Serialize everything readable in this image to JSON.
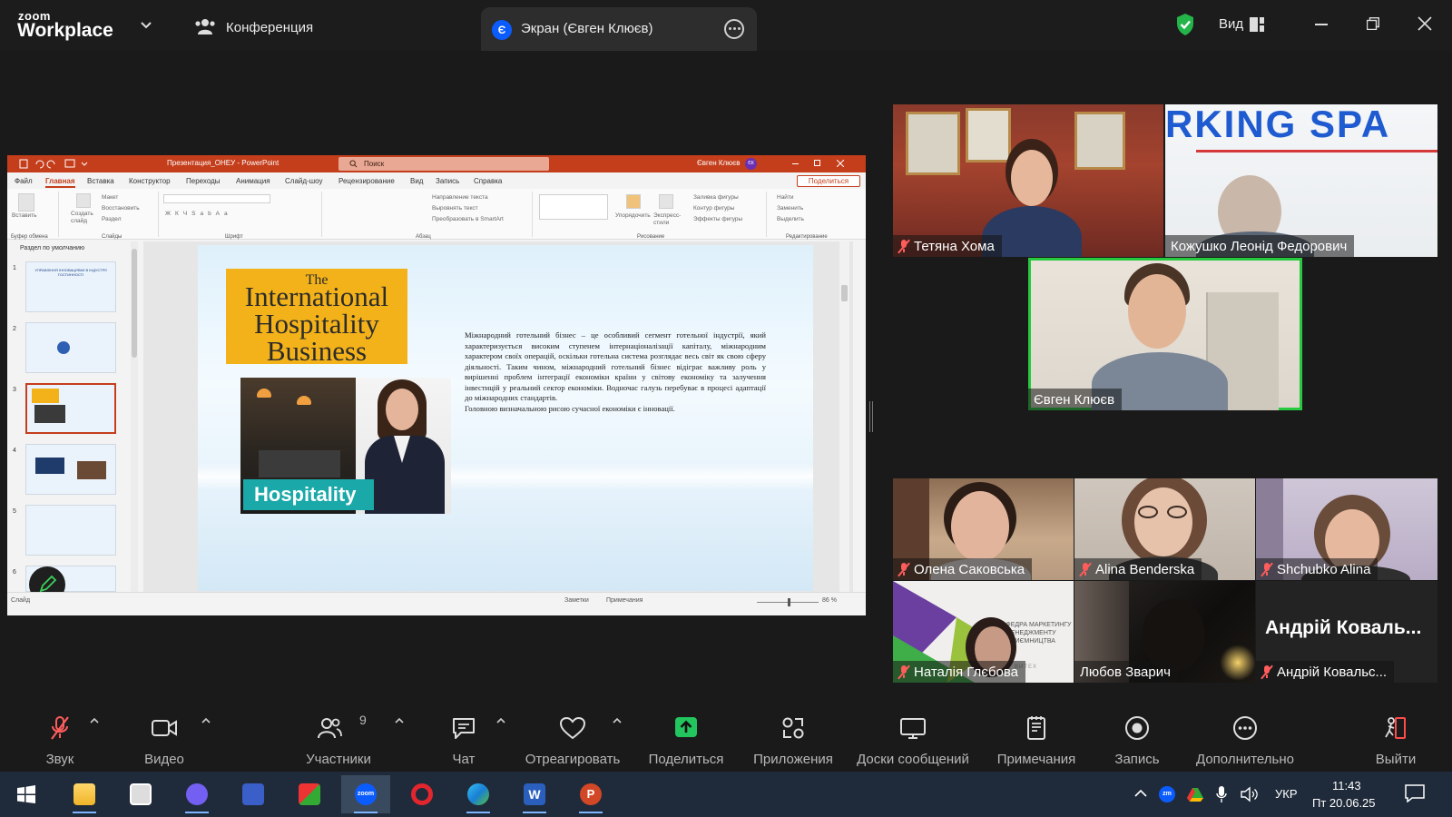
{
  "header": {
    "logo_small": "zoom",
    "logo_big": "Workplace",
    "conference_label": "Конференция",
    "screen_tab_initial": "Є",
    "screen_tab_label": "Экран (Євген Клюєв)",
    "view_label": "Вид",
    "shield_color": "#24b54a"
  },
  "ppt": {
    "doc_title": "Презентация_ОНЕУ - PowerPoint",
    "search_placeholder": "Поиск",
    "user_name": "Євген Клюєв",
    "user_initials": "ЄК",
    "share_label": "Поделиться",
    "tabs": [
      "Файл",
      "Главная",
      "Вставка",
      "Конструктор",
      "Переходы",
      "Анимация",
      "Слайд-шоу",
      "Рецензирование",
      "Вид",
      "Запись",
      "Справка"
    ],
    "active_tab": "Главная",
    "ribbon": {
      "paste": "Вставить",
      "create_slide": "Создать слайд",
      "layout": "Макет",
      "reset": "Восстановить",
      "section": "Раздел",
      "text_direction": "Направление текста",
      "align_text": "Выровнять текст",
      "smartart": "Преобразовать в SmartArt",
      "arrange": "Упорядочить",
      "quick_styles": "Экспресс-стили",
      "fill": "Заливка фигуры",
      "outline": "Контур фигуры",
      "effects": "Эффекты фигуры",
      "find": "Найти",
      "replace": "Заменить",
      "select": "Выделить",
      "groups": [
        "Буфер обмена",
        "Слайды",
        "Шрифт",
        "Абзац",
        "Рисование",
        "Редактирование"
      ]
    },
    "section_label": "Раздел по умолчанию",
    "thumb_numbers": [
      "1",
      "2",
      "3",
      "4",
      "5",
      "6"
    ],
    "thumb1_title": "УПРАВЛІННЯ ІННОВАЦІЯМИ В ІНДУСТРІЇ ГОСТИННОСТІ",
    "slide": {
      "title_the": "The",
      "title_main": "International Hospitality Business",
      "image_label": "Hospitality",
      "paragraph1": "Міжнародний готельний бізнес – це особливий сегмент готельної індустрії, який характеризується високим ступенем інтернаціоналізації капіталу, міжнародним характером своїх операцій, оскільки готельна система розглядає весь світ як свою сферу діяльності. Таким чином, міжнародний готельний бізнес відіграє важливу роль у вирішенні проблем інтеграції економіки країни у світову економіку та залучення інвестицій у реальний сектор економіки. Водночас галузь перебуває в процесі адаптації до міжнародних стандартів.",
      "paragraph2": "Головною визначальною рисою сучасної економіки є інновації."
    },
    "status": {
      "slide": "Слайд",
      "notes": "Заметки",
      "comments": "Примечания",
      "zoom": "86 %"
    }
  },
  "participants_tiles": [
    {
      "name": "Тетяна Хома",
      "muted": true
    },
    {
      "name": "Кожушко Леонід Федорович",
      "muted": false
    },
    {
      "name": "Євген Клюєв",
      "muted": false,
      "active": true
    },
    {
      "name": "Олена Саковська",
      "muted": true
    },
    {
      "name": "Alina Benderska",
      "muted": true
    },
    {
      "name": "Shchubko Alina",
      "muted": true
    },
    {
      "name": "Наталія Глєбова",
      "muted": true
    },
    {
      "name": "Любов Зварич",
      "muted": false
    },
    {
      "name": "Андрій Ковальс...",
      "muted": true,
      "display_text": "Андрій Коваль..."
    }
  ],
  "tile_texts": {
    "banner": "RKING SPA",
    "poster": "АФЕДРА МАРКЕТИНГУ І МЕНЕДЖМЕНТУ ДПРИЄМНИЦТВА",
    "poster_footer": "ВИТЕХ"
  },
  "toolbar": {
    "audio": "Звук",
    "video": "Видео",
    "participants": "Участники",
    "participants_count": "9",
    "chat": "Чат",
    "react": "Отреагировать",
    "share": "Поделиться",
    "apps": "Приложения",
    "whiteboards": "Доски сообщений",
    "notes": "Примечания",
    "record": "Запись",
    "more": "Дополнительно",
    "leave": "Выйти",
    "share_color": "#22c55e",
    "leave_color": "#ff4b4b"
  },
  "taskbar": {
    "tray_zoom": "zm",
    "language": "УКР",
    "time": "11:43",
    "date": "Пт 20.06.25",
    "zoom_app": "zoom",
    "word_app": "W",
    "ppt_app": "P"
  }
}
